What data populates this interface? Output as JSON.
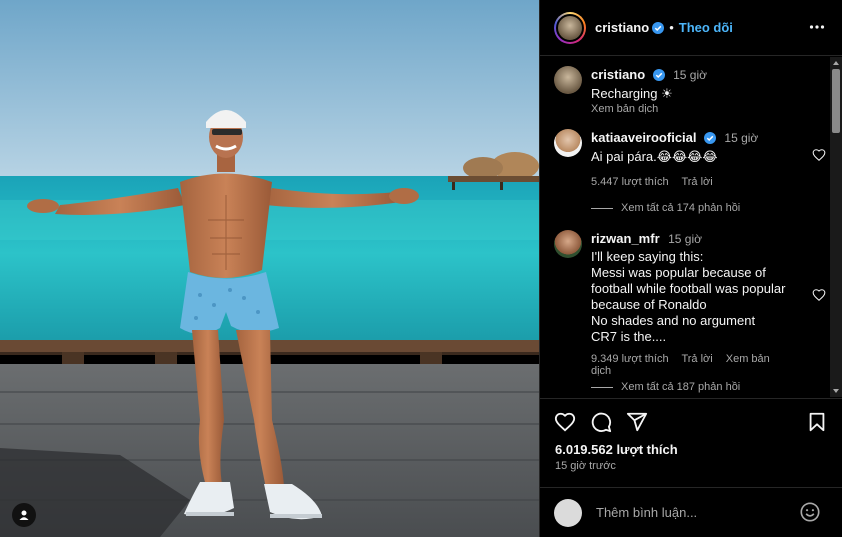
{
  "post": {
    "username": "cristiano",
    "follow_label": "Theo dõi",
    "more_icon": "more-horizontal-icon",
    "tag_icon": "user-tag-icon"
  },
  "caption": {
    "username": "cristiano",
    "time": "15 giờ",
    "text": "Recharging ☀",
    "translate_label": "Xem bản dịch"
  },
  "comments": [
    {
      "username": "katiaaveirooficial",
      "verified": true,
      "time": "15 giờ",
      "text": "Ai pai pára.😂😂😂😂",
      "likes": "5.447 lượt thích",
      "reply_label": "Trả lời",
      "view_replies": "Xem tất cả 174 phản hồi"
    },
    {
      "username": "rizwan_mfr",
      "verified": false,
      "time": "15 giờ",
      "text": "I'll keep saying this:\nMessi was popular because of football while football was popular because of Ronaldo\nNo shades and no argument\nCR7 is the....",
      "likes": "9.349 lượt thích",
      "reply_label": "Trả lời",
      "translate_label": "Xem bản dịch",
      "view_replies": "Xem tất cả 187 phản hồi"
    }
  ],
  "actions": {
    "like_icon": "heart-icon",
    "comment_icon": "comment-icon",
    "share_icon": "send-icon",
    "save_icon": "bookmark-icon",
    "likes": "6.019.562 lượt thích",
    "time_ago": "15 giờ trước"
  },
  "add_comment": {
    "placeholder": "Thêm bình luận...",
    "emoji_icon": "emoji-icon"
  },
  "colors": {
    "background": "#000000",
    "link_blue": "#4cb5f9",
    "verified_blue": "#3897f0",
    "secondary_text": "#a8a8a8",
    "divider": "#262626"
  }
}
